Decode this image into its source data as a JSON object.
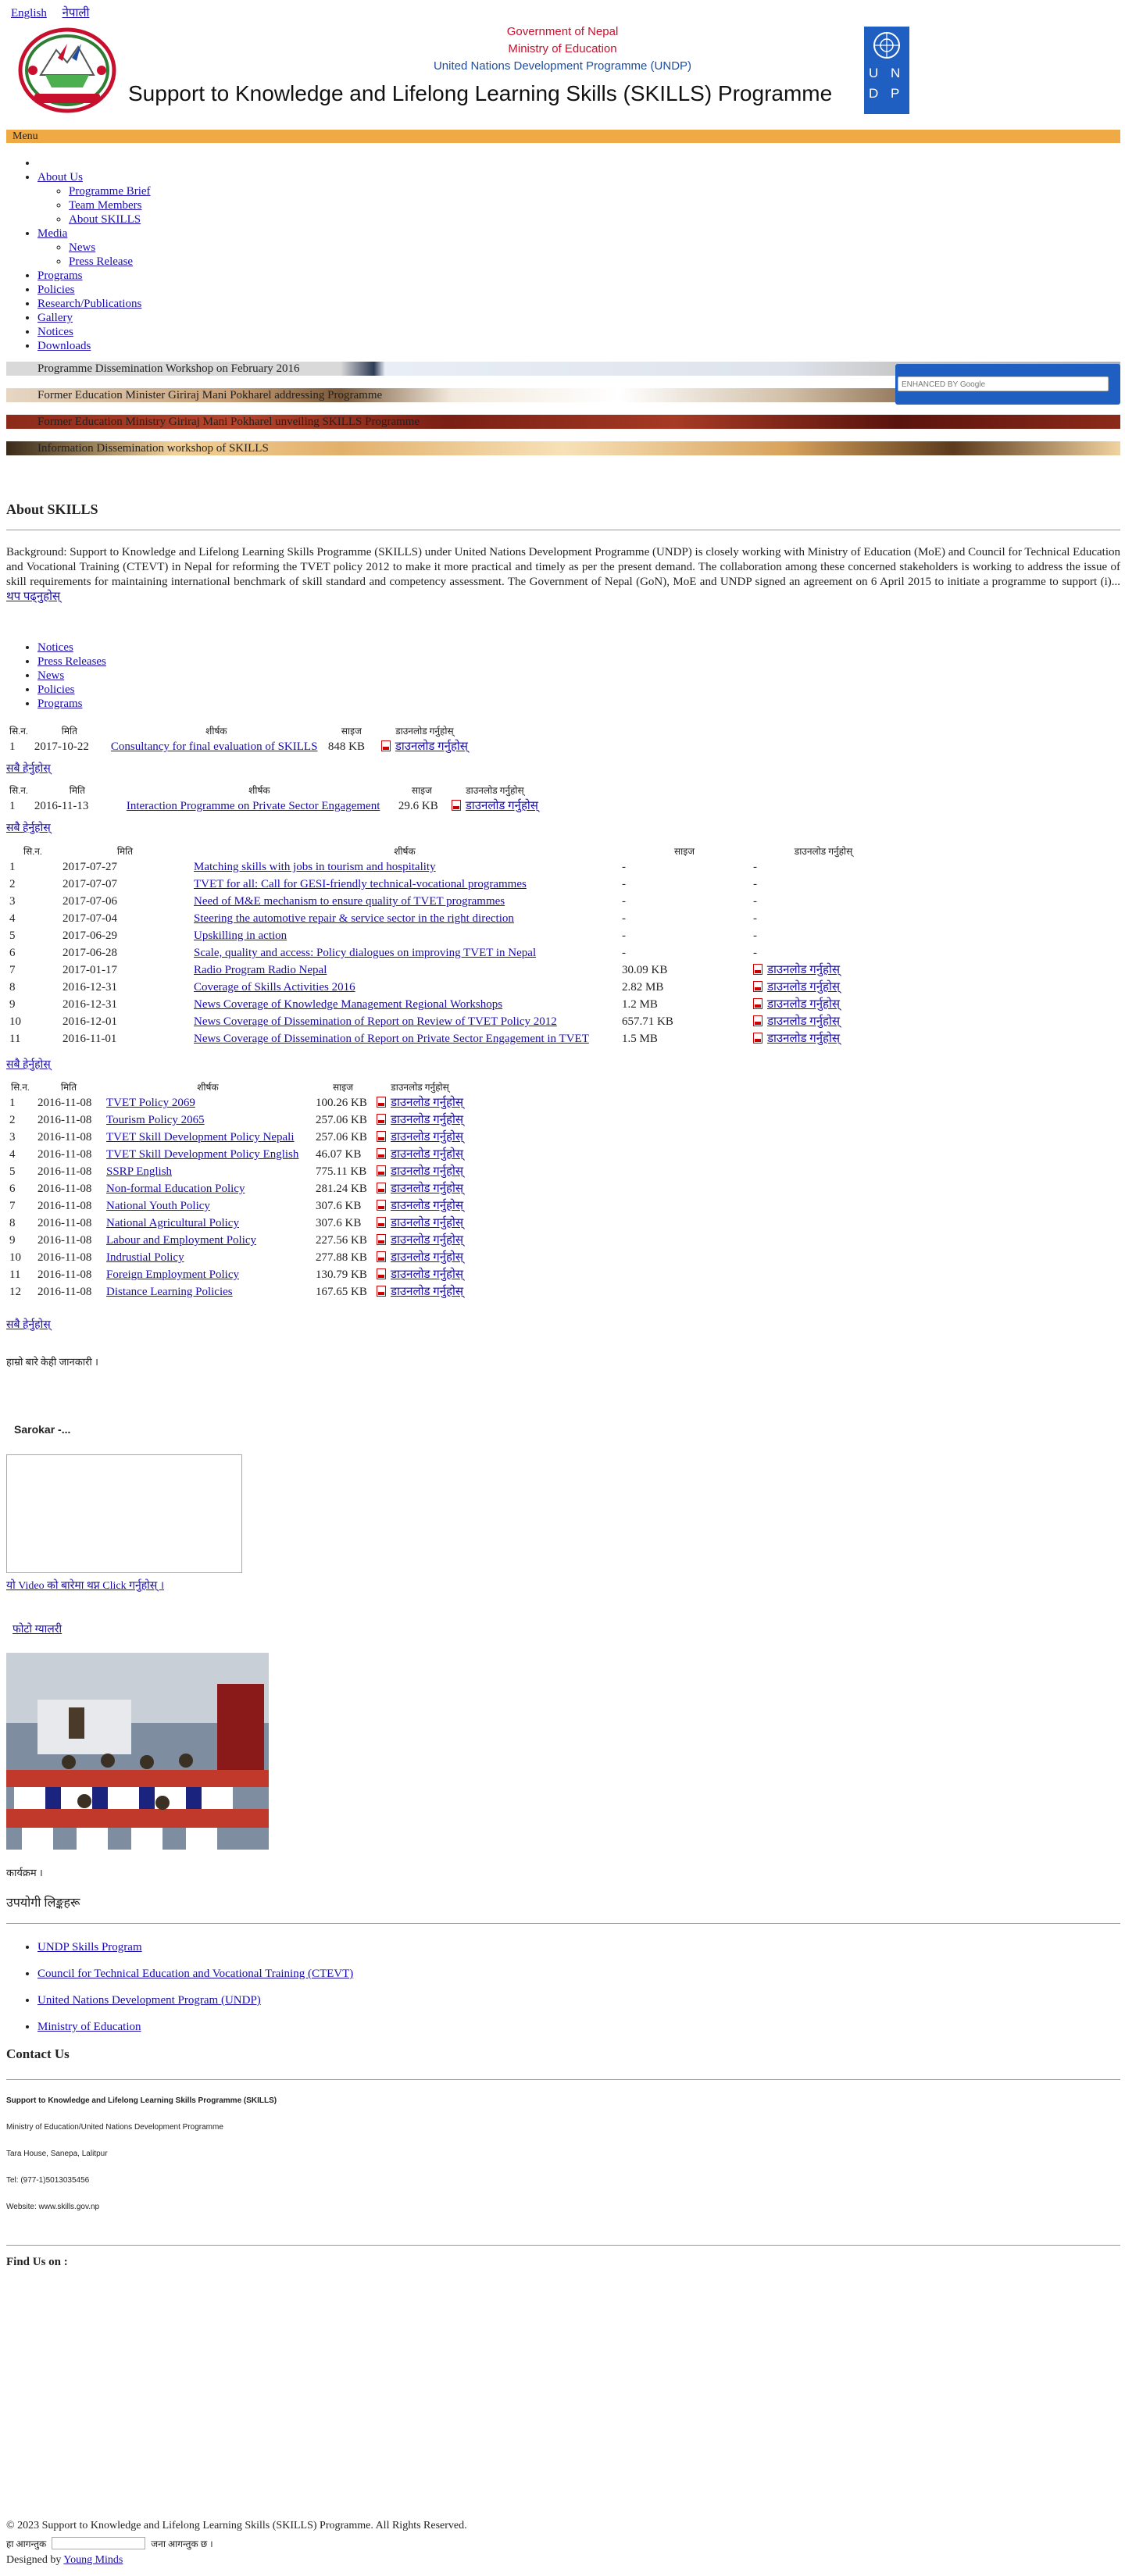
{
  "lang": {
    "english": "English",
    "nepali": "नेपाली"
  },
  "header": {
    "gov": "Government of Nepal",
    "ministry": "Ministry of Education",
    "undp": "United Nations Development Programme (UNDP)",
    "title": "Support to Knowledge and Lifelong Learning Skills (SKILLS) Programme",
    "undp_logo_letters": [
      "U",
      "N",
      "D",
      "P"
    ]
  },
  "menu": {
    "label": "Menu"
  },
  "nav": {
    "about": "About Us",
    "about_sub": [
      "Programme Brief",
      "Team Members",
      "About SKILLS"
    ],
    "media": "Media",
    "media_sub": [
      "News",
      "Press Release"
    ],
    "items": [
      "Programs",
      "Policies",
      "Research/Publications",
      "Gallery",
      "Notices",
      "Downloads"
    ]
  },
  "slides": [
    "Programme Dissemination Workshop on February 2016",
    "Former Education Minister Giriraj Mani Pokharel addressing Programme",
    "Former Education Ministry Giriraj Mani Pokharel unveiling SKILLS Programme",
    "Information Dissemination workshop of SKILLS"
  ],
  "search": {
    "placeholder": "ENHANCED BY Google"
  },
  "about": {
    "title": "About SKILLS",
    "text": "Background: Support to Knowledge and Lifelong Learning Skills Programme (SKILLS) under United Nations Development Programme (UNDP) is closely working with  Ministry of Education (MoE) and Council for Technical Education and Vocational Training (CTEVT) in Nepal for reforming the TVET policy 2012 to make it more practical and timely as per the present demand. The collaboration among these concerned stakeholders is working to address the issue of skill requirements for maintaining international benchmark of skill standard and competency assessment. The Government of Nepal (GoN), MoE and UNDP signed an agreement on 6 April 2015 to initiate a programme to support (i)...",
    "more": "थप पढ्नुहोस्"
  },
  "tabs": [
    "Notices",
    "Press Releases",
    "News",
    "Policies",
    "Programs"
  ],
  "table_headers": [
    "सि.न.",
    "मिति",
    "शीर्षक",
    "साइज",
    "डाउनलोड गर्नुहोस्"
  ],
  "download_label": "डाउनलोड गर्नुहोस्",
  "view_all": "सबै हेर्नुहोस्",
  "notices": [
    {
      "n": "1",
      "date": "2017-10-22",
      "title": "Consultancy for final evaluation of SKILLS",
      "size": "848 KB"
    }
  ],
  "press": [
    {
      "n": "1",
      "date": "2016-11-13",
      "title": "Interaction Programme on Private Sector Engagement",
      "size": "29.6 KB"
    }
  ],
  "news": [
    {
      "n": "1",
      "date": "2017-07-27",
      "title": "Matching skills with jobs in tourism and hospitality",
      "size": "-",
      "dl": "-"
    },
    {
      "n": "2",
      "date": "2017-07-07",
      "title": "TVET for all: Call for GESI-friendly technical-vocational programmes",
      "size": "-",
      "dl": "-"
    },
    {
      "n": "3",
      "date": "2017-07-06",
      "title": "Need of M&E mechanism to ensure quality of TVET programmes",
      "size": "-",
      "dl": "-"
    },
    {
      "n": "4",
      "date": "2017-07-04",
      "title": "Steering the automotive repair & service sector in the right direction",
      "size": "-",
      "dl": "-"
    },
    {
      "n": "5",
      "date": "2017-06-29",
      "title": "Upskilling in action",
      "size": "-",
      "dl": "-"
    },
    {
      "n": "6",
      "date": "2017-06-28",
      "title": "Scale, quality and access: Policy dialogues on improving TVET in Nepal",
      "size": "-",
      "dl": "-"
    },
    {
      "n": "7",
      "date": "2017-01-17",
      "title": "Radio Program   Radio Nepal",
      "size": "30.09 KB",
      "dl": "yes"
    },
    {
      "n": "8",
      "date": "2016-12-31",
      "title": "Coverage of Skills Activities 2016",
      "size": "2.82 MB",
      "dl": "yes"
    },
    {
      "n": "9",
      "date": "2016-12-31",
      "title": "News Coverage of Knowledge Management Regional Workshops",
      "size": "1.2 MB",
      "dl": "yes"
    },
    {
      "n": "10",
      "date": "2016-12-01",
      "title": "News Coverage of Dissemination of Report on Review of TVET Policy 2012",
      "size": "657.71 KB",
      "dl": "yes"
    },
    {
      "n": "11",
      "date": "2016-11-01",
      "title": "News Coverage of Dissemination of Report on Private Sector Engagement in TVET",
      "size": "1.5 MB",
      "dl": "yes"
    }
  ],
  "policies": [
    {
      "n": "1",
      "date": "2016-11-08",
      "title": "TVET Policy 2069",
      "size": "100.26 KB"
    },
    {
      "n": "2",
      "date": "2016-11-08",
      "title": "Tourism Policy 2065",
      "size": "257.06 KB"
    },
    {
      "n": "3",
      "date": "2016-11-08",
      "title": "TVET Skill Development Policy Nepali",
      "size": "257.06 KB"
    },
    {
      "n": "4",
      "date": "2016-11-08",
      "title": "TVET Skill Development Policy English",
      "size": "46.07 KB"
    },
    {
      "n": "5",
      "date": "2016-11-08",
      "title": "SSRP English",
      "size": "775.11 KB"
    },
    {
      "n": "6",
      "date": "2016-11-08",
      "title": "Non-formal Education Policy",
      "size": "281.24 KB"
    },
    {
      "n": "7",
      "date": "2016-11-08",
      "title": "National Youth Policy",
      "size": "307.6 KB"
    },
    {
      "n": "8",
      "date": "2016-11-08",
      "title": "National Agricultural Policy",
      "size": "307.6 KB"
    },
    {
      "n": "9",
      "date": "2016-11-08",
      "title": "Labour and Employment Policy",
      "size": "227.56 KB"
    },
    {
      "n": "10",
      "date": "2016-11-08",
      "title": "Indrustial Policy",
      "size": "277.88 KB"
    },
    {
      "n": "11",
      "date": "2016-11-08",
      "title": "Foreign Employment Policy",
      "size": "130.79 KB"
    },
    {
      "n": "12",
      "date": "2016-11-08",
      "title": "Distance Learning Policies",
      "size": "167.65 KB"
    }
  ],
  "sidebar": {
    "note": "हाम्रो बारे केही जानकारी ।",
    "video_title": "Sarokar -...",
    "video_link": "यो Video को बारेमा थप्न Click गर्नुहोस् ।",
    "gallery_link": "फोटो ग्यालरी",
    "photo_caption": "कार्यक्रम ।"
  },
  "links": {
    "title": "उपयोगी लिङ्कहरू",
    "items": [
      "UNDP Skills Program",
      "Council for Technical Education and Vocational Training (CTEVT)",
      "United Nations Development Program (UNDP)",
      "Ministry of Education"
    ]
  },
  "contact": {
    "title": "Contact Us",
    "org": "Support to Knowledge and Lifelong Learning Skills Programme (SKILLS)",
    "line2": "Ministry of Education/United Nations Development Programme",
    "address": "Tara House, Sanepa, Lalitpur",
    "tel": "Tel: (977-1)5013035456",
    "website": "Website: www.skills.gov.np"
  },
  "find_us": "Find Us on :",
  "footer": {
    "copyright": "© 2023 Support to Knowledge and Lifelong Learning Skills (SKILLS) Programme. All Rights Reserved.",
    "visitor_prefix": "हा आगन्तुक",
    "visitor_suffix": "जना आगन्तुक छ ।",
    "designed_by": "Designed by",
    "designer": "Young Minds"
  },
  "colors": {
    "menu": "#f0aa45",
    "undp_blue": "#1f5fc1",
    "gov_red": "#c8102e",
    "link": "#1a0dab"
  }
}
